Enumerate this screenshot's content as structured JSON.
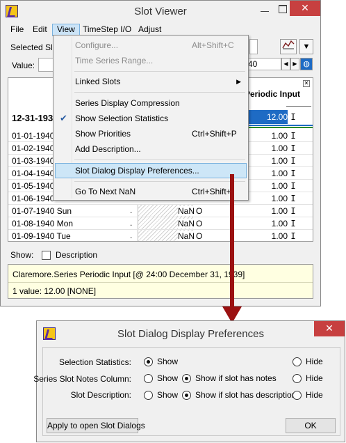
{
  "slot_viewer": {
    "title": "Slot Viewer",
    "menu": [
      "File",
      "Edit",
      "View",
      "TimeStep I/O",
      "Adjust"
    ],
    "selected_label": "Selected Slo",
    "value_label": "Value:",
    "range_end_partial": "40",
    "column_header_partial": "Periodic Input",
    "summary_row": {
      "date": "12-31-193",
      "value": "12.00",
      "flag": "I"
    },
    "rows": [
      {
        "date": "01-01-1940",
        "value": "1.00",
        "flag": "I"
      },
      {
        "date": "01-02-1940",
        "value": "1.00",
        "flag": "I"
      },
      {
        "date": "01-03-1940",
        "value": "1.00",
        "flag": "I"
      },
      {
        "date": "01-04-1940",
        "value": "1.00",
        "flag": "I"
      },
      {
        "date": "01-05-1940",
        "value": "1.00",
        "flag": "I"
      },
      {
        "date": "01-06-1940",
        "value": "1.00",
        "flag": "I"
      },
      {
        "date": "01-07-1940 Sun",
        "dot": ".",
        "nan": "NaN",
        "o": "O",
        "value": "1.00",
        "flag": "I"
      },
      {
        "date": "01-08-1940 Mon",
        "dot": ".",
        "nan": "NaN",
        "o": "O",
        "value": "1.00",
        "flag": "I"
      },
      {
        "date": "01-09-1940 Tue",
        "dot": ".",
        "nan": "NaN",
        "o": "O",
        "value": "1.00",
        "flag": "I"
      }
    ],
    "show_label": "Show:",
    "description_label": "Description",
    "status_line1": "Claremore.Series Periodic Input [@ 24:00 December 31, 1939]",
    "status_line2": "1 value:  12.00 [NONE]",
    "close_glyph": "✕"
  },
  "view_menu": {
    "items": [
      {
        "label": "Configure...",
        "accel": "Alt+Shift+C",
        "disabled": true
      },
      {
        "label": "Time Series Range...",
        "disabled": true
      },
      {
        "label": "Linked Slots",
        "submenu": true
      },
      {
        "label": "Series Display Compression"
      },
      {
        "label": "Show Selection Statistics",
        "checked": true
      },
      {
        "label": "Show Priorities",
        "accel": "Ctrl+Shift+P"
      },
      {
        "label": "Add Description..."
      },
      {
        "label": "Slot Dialog Display Preferences...",
        "highlighted": true
      },
      {
        "label": "Go To Next NaN",
        "accel": "Ctrl+Shift+"
      }
    ]
  },
  "prefs_dialog": {
    "title": "Slot Dialog Display Preferences",
    "rows": [
      {
        "label": "Selection Statistics:",
        "options": [
          "Show",
          "Hide"
        ],
        "selected": "Show"
      },
      {
        "label": "Series Slot Notes Column:",
        "options": [
          "Show",
          "Show if slot has notes",
          "Hide"
        ],
        "selected": "Show if slot has notes"
      },
      {
        "label": "Slot Description:",
        "options": [
          "Show",
          "Show if slot has description",
          "Hide"
        ],
        "selected": "Show if slot has description"
      }
    ],
    "apply_button": "Apply to open Slot Dialogs",
    "ok_button": "OK",
    "close_glyph": "✕"
  },
  "colors": {
    "arrow": "#9b1111",
    "highlight": "#cde6f7",
    "status_bg": "#ffffe1"
  }
}
